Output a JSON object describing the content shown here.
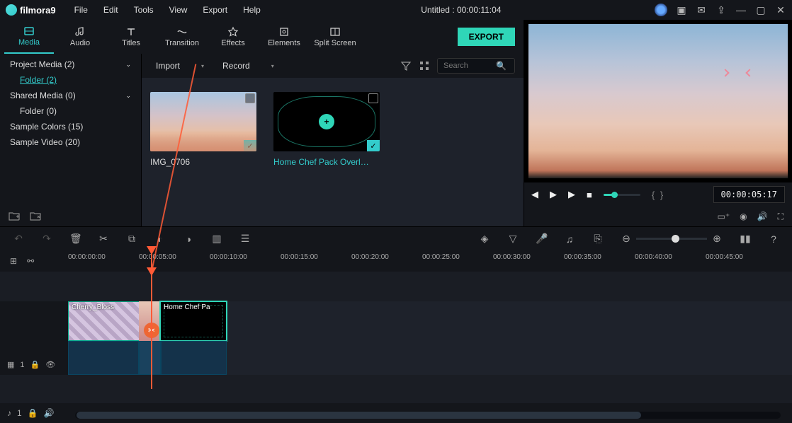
{
  "app": {
    "name": "filmora9",
    "title": "Untitled : 00:00:11:04"
  },
  "menu": {
    "file": "File",
    "edit": "Edit",
    "tools": "Tools",
    "view": "View",
    "export": "Export",
    "help": "Help"
  },
  "tabs": {
    "media": "Media",
    "audio": "Audio",
    "titles": "Titles",
    "transition": "Transition",
    "effects": "Effects",
    "elements": "Elements",
    "split": "Split Screen",
    "export_btn": "EXPORT"
  },
  "tree": {
    "project": "Project Media (2)",
    "folder": "Folder (2)",
    "shared": "Shared Media (0)",
    "shared_folder": "Folder (0)",
    "sample_colors": "Sample Colors (15)",
    "sample_video": "Sample Video (20)"
  },
  "libbar": {
    "import": "Import",
    "record": "Record",
    "search_placeholder": "Search"
  },
  "thumbs": {
    "a": "IMG_0706",
    "b": "Home Chef Pack Overl…"
  },
  "preview": {
    "time": "00:00:05:17",
    "markers": "{  }"
  },
  "ruler": {
    "t0": "00:00:00:00",
    "t5": "00:00:05:00",
    "t10": "00:00:10:00",
    "t15": "00:00:15:00",
    "t20": "00:00:20:00",
    "t25": "00:00:25:00",
    "t30": "00:00:30:00",
    "t35": "00:00:35:00",
    "t40": "00:00:40:00",
    "t45": "00:00:45:00"
  },
  "clips": {
    "a": "Cherry_Bloss",
    "b": "Home Chef Pa"
  },
  "trackLabels": {
    "video": "1",
    "audio": "1"
  },
  "icons": {
    "film": "▦",
    "lock": "🔒",
    "eye": "👁",
    "note": "♪"
  }
}
